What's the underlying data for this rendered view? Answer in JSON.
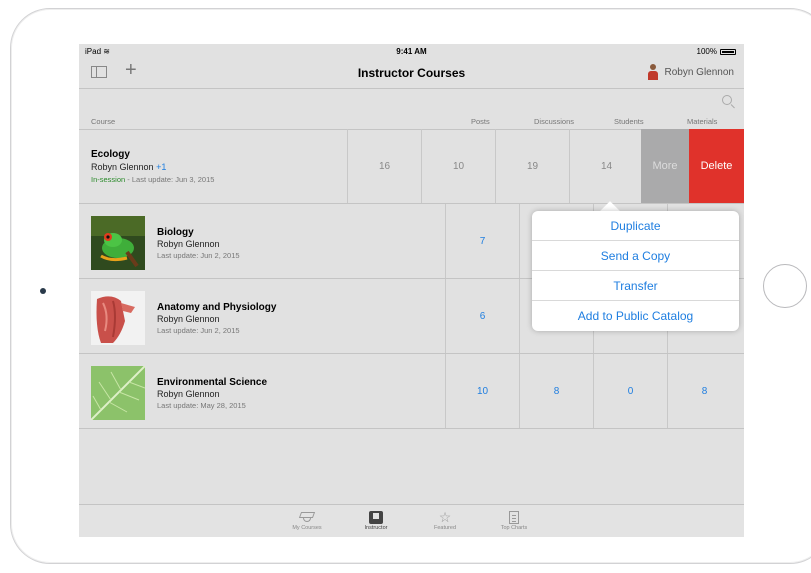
{
  "status_bar": {
    "device": "iPad",
    "time": "9:41 AM",
    "battery": "100%"
  },
  "nav": {
    "title": "Instructor Courses",
    "user_name": "Robyn Glennon"
  },
  "columns": {
    "course": "Course",
    "posts": "Posts",
    "discussions": "Discussions",
    "students": "Students",
    "materials": "Materials"
  },
  "ecology": {
    "title": "Ecology",
    "author": "Robyn Glennon",
    "extra": "+1",
    "status": "In-session",
    "update": " - Last update: Jun 3, 2015",
    "posts": "16",
    "discussions": "10",
    "students": "19",
    "materials": "14",
    "more_label": "More",
    "delete_label": "Delete"
  },
  "courses": [
    {
      "title": "Biology",
      "author": "Robyn Glennon",
      "update": "Last update: Jun 2, 2015",
      "posts": "7"
    },
    {
      "title": "Anatomy and Physiology",
      "author": "Robyn Glennon",
      "update": "Last update: Jun 2, 2015",
      "posts": "6"
    },
    {
      "title": "Environmental Science",
      "author": "Robyn Glennon",
      "update": "Last update: May 28, 2015",
      "posts": "10",
      "discussions": "8",
      "students": "0",
      "materials": "8"
    }
  ],
  "popover": {
    "items": [
      "Duplicate",
      "Send a Copy",
      "Transfer",
      "Add to Public Catalog"
    ]
  },
  "tabs": [
    "My Courses",
    "Instructor",
    "Featured",
    "Top Charts"
  ],
  "icons": {
    "wifi": "wifi-icon",
    "sidebar": "sidebar-toggle-icon",
    "add": "plus-icon",
    "search": "search-icon"
  },
  "colors": {
    "accent": "#1f7ee0",
    "delete": "#e0322b",
    "more": "#aaaaab",
    "in_session": "#2b8a2b"
  }
}
